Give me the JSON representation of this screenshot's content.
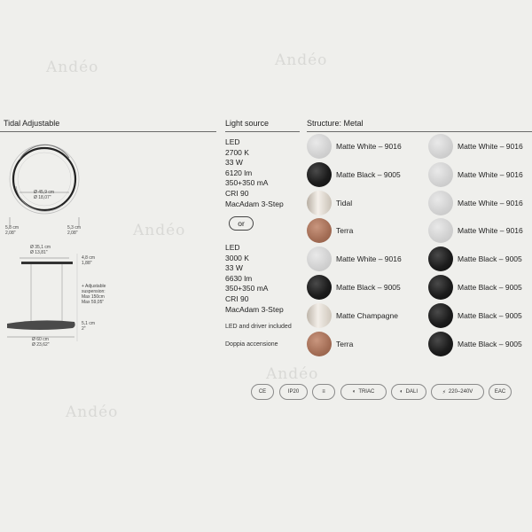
{
  "watermark": "Andéo",
  "product": {
    "title": "Tidal Adjustable"
  },
  "headers": {
    "light_source": "Light source",
    "structure": "Structure: Metal"
  },
  "light_source": {
    "option1": [
      "LED",
      "2700 K",
      "33 W",
      "6120 lm",
      "350+350 mA",
      "CRI 90",
      "MacAdam 3-Step"
    ],
    "or_label": "or",
    "option2": [
      "LED",
      "3000 K",
      "33 W",
      "6630 lm",
      "350+350 mA",
      "CRI 90",
      "MacAdam 3-Step"
    ],
    "note1": "LED and driver included",
    "note2": "Doppia accensione"
  },
  "finishes_left": [
    {
      "label": "Matte White – 9016",
      "swatch": "white"
    },
    {
      "label": "Matte Black – 9005",
      "swatch": "black"
    },
    {
      "label": "Tidal",
      "swatch": "tidal"
    },
    {
      "label": "Terra",
      "swatch": "terra"
    },
    {
      "label": "Matte White – 9016",
      "swatch": "white"
    },
    {
      "label": "Matte Black – 9005",
      "swatch": "black"
    },
    {
      "label": "Matte Champagne",
      "swatch": "champagne"
    },
    {
      "label": "Terra",
      "swatch": "terra"
    }
  ],
  "finishes_right": [
    {
      "label": "Matte White – 9016",
      "swatch": "white"
    },
    {
      "label": "Matte White – 9016",
      "swatch": "white"
    },
    {
      "label": "Matte White – 9016",
      "swatch": "white"
    },
    {
      "label": "Matte White – 9016",
      "swatch": "white"
    },
    {
      "label": "Matte Black – 9005",
      "swatch": "black"
    },
    {
      "label": "Matte Black – 9005",
      "swatch": "black"
    },
    {
      "label": "Matte Black – 9005",
      "swatch": "black"
    },
    {
      "label": "Matte Black – 9005",
      "swatch": "black"
    }
  ],
  "dimensions": {
    "ring_outer": "Ø 45,9 cm",
    "ring_outer_in": "Ø 18,07\"",
    "left_depth": "5,8 cm",
    "left_depth_in": "2,08\"",
    "right_depth": "5,3 cm",
    "right_depth_in": "2,08\"",
    "canopy": "Ø 35,1 cm",
    "canopy_in": "Ø 13,81\"",
    "canopy_h": "4,8 cm",
    "canopy_h_in": "1,88\"",
    "suspension": [
      "+ Adjustable",
      "suspension:",
      "Max 150cm",
      "Max 59,05\""
    ],
    "ring_h": "5,1 cm",
    "ring_h_in": "2\"",
    "ring_d": "Ø 60 cm",
    "ring_d_in": "Ø 23,62\""
  },
  "certifications": [
    "CE",
    "IP20",
    "≡",
    "TRIAC",
    "DALI",
    "220–240V",
    "EAC"
  ]
}
